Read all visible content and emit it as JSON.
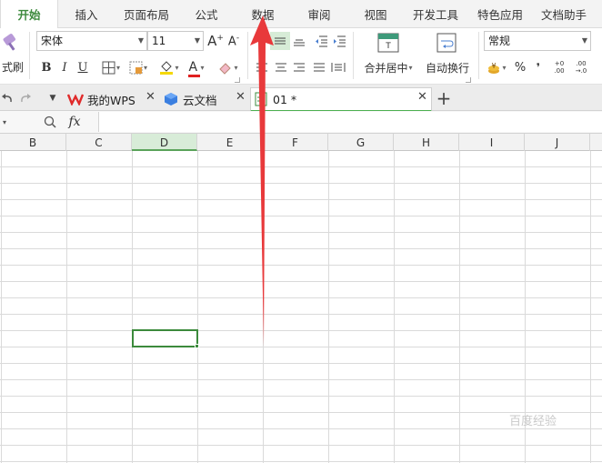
{
  "menu": {
    "tabs": [
      {
        "label": "开始",
        "active": true
      },
      {
        "label": "插入"
      },
      {
        "label": "页面布局"
      },
      {
        "label": "公式"
      },
      {
        "label": "数据"
      },
      {
        "label": "审阅"
      },
      {
        "label": "视图"
      },
      {
        "label": "开发工具"
      },
      {
        "label": "特色应用"
      },
      {
        "label": "文档助手"
      }
    ]
  },
  "ribbon": {
    "format_painter_label": "式刷",
    "font_name": "宋体",
    "font_size": "11",
    "number_format": "常规",
    "merge_center_label": "合并居中",
    "wrap_text_label": "自动换行",
    "bold": "B",
    "italic": "I",
    "underline": "U",
    "font_color_letter": "A",
    "percent": "%",
    "comma": "❜"
  },
  "docbar": {
    "tabs": [
      {
        "label": "我的WPS"
      },
      {
        "label": "云文档"
      },
      {
        "label": "01 *",
        "active": true
      }
    ],
    "add_label": "+"
  },
  "formula_bar": {
    "fx_label": "fx",
    "value": ""
  },
  "grid": {
    "columns": [
      "B",
      "C",
      "D",
      "E",
      "F",
      "G",
      "H",
      "I",
      "J"
    ],
    "selected_column": "D"
  },
  "watermark": "百度经验",
  "colors": {
    "accent": "#3c8a3c",
    "arrow": "#e8393b"
  }
}
